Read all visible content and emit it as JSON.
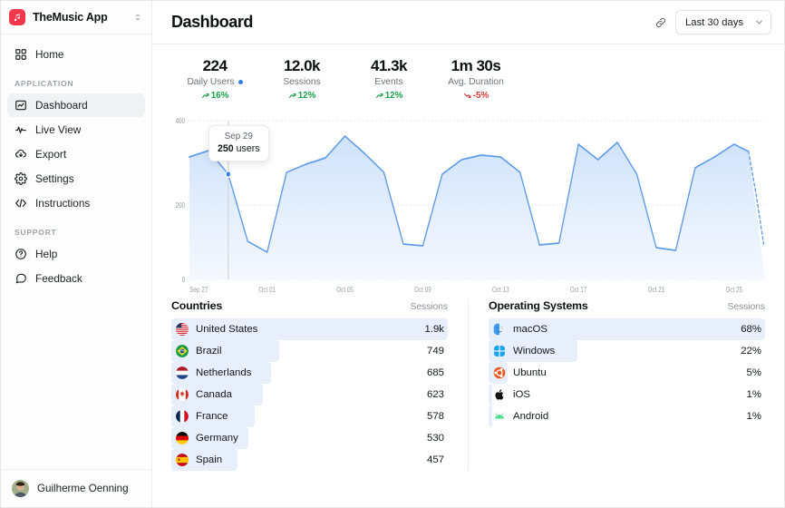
{
  "sidebar": {
    "brand": {
      "name": "TheMusic App",
      "logo_icon": "music-note-icon",
      "chevron_icon": "chevron-updown-icon",
      "logo_color": "#f2374a"
    },
    "top_items": [
      {
        "label": "Home",
        "icon": "grid-icon"
      }
    ],
    "groups": [
      {
        "label": "APPLICATION",
        "items": [
          {
            "label": "Dashboard",
            "icon": "chart-box-icon",
            "active": true
          },
          {
            "label": "Live View",
            "icon": "pulse-icon",
            "active": false
          },
          {
            "label": "Export",
            "icon": "cloud-download-icon",
            "active": false
          },
          {
            "label": "Settings",
            "icon": "gear-icon",
            "active": false
          },
          {
            "label": "Instructions",
            "icon": "code-icon",
            "active": false
          }
        ]
      },
      {
        "label": "SUPPORT",
        "items": [
          {
            "label": "Help",
            "icon": "question-circle-icon",
            "active": false
          },
          {
            "label": "Feedback",
            "icon": "chat-bubble-icon",
            "active": false
          }
        ]
      }
    ],
    "user": {
      "name": "Guilherme Oenning",
      "avatar_icon": "avatar"
    }
  },
  "header": {
    "title": "Dashboard",
    "link_icon": "link-icon",
    "date_range": {
      "value": "Last 30 days",
      "chevron_icon": "chevron-down-icon"
    }
  },
  "stats": [
    {
      "value": "224",
      "label": "Daily Users",
      "delta": "16%",
      "direction": "up",
      "has_dot": true,
      "dot_color": "#2e7ee8"
    },
    {
      "value": "12.0k",
      "label": "Sessions",
      "delta": "12%",
      "direction": "up",
      "has_dot": false
    },
    {
      "value": "41.3k",
      "label": "Events",
      "delta": "12%",
      "direction": "up",
      "has_dot": false
    },
    {
      "value": "1m 30s",
      "label": "Avg. Duration",
      "delta": "-5%",
      "direction": "down",
      "has_dot": false
    }
  ],
  "chart_data": {
    "type": "area",
    "title": "",
    "xlabel": "",
    "ylabel": "",
    "ylim": [
      0,
      400
    ],
    "yticks": [
      0,
      200,
      400
    ],
    "ytick_labels": [
      "0",
      "200",
      "400"
    ],
    "grid": true,
    "legend": null,
    "line_color": "#5e9bea",
    "fill_color": "#dbe9fb",
    "x": [
      "Sep 27",
      "Sep 28",
      "Sep 29",
      "Sep 30",
      "Oct 01",
      "Oct 02",
      "Oct 03",
      "Oct 04",
      "Oct 05",
      "Oct 06",
      "Oct 07",
      "Oct 08",
      "Oct 09",
      "Oct 10",
      "Oct 11",
      "Oct 12",
      "Oct 13",
      "Oct 14",
      "Oct 15",
      "Oct 16",
      "Oct 17",
      "Oct 18",
      "Oct 19",
      "Oct 20",
      "Oct 21",
      "Oct 22",
      "Oct 23",
      "Oct 24",
      "Oct 25",
      "Oct 26"
    ],
    "xtick_labels": [
      "Sep 27",
      "Oct 01",
      "Oct 05",
      "Oct 09",
      "Oct 13",
      "Oct 17",
      "Oct 21",
      "Oct 25"
    ],
    "values": [
      290,
      305,
      250,
      90,
      65,
      255,
      275,
      290,
      340,
      300,
      255,
      85,
      80,
      250,
      285,
      295,
      290,
      255,
      85,
      90,
      320,
      285,
      325,
      250,
      75,
      70,
      265,
      290,
      320,
      300
    ],
    "forecast_values": [
      300,
      230,
      150
    ],
    "highlight_point": {
      "x": "Sep 29",
      "y": 250
    },
    "tooltip": {
      "date": "Sep 29",
      "value": "250",
      "unit": "users"
    }
  },
  "countries_panel": {
    "title": "Countries",
    "value_header": "Sessions",
    "rows": [
      {
        "label": "United States",
        "value": "1.9k",
        "pct": 100,
        "flag": "flag-us"
      },
      {
        "label": "Brazil",
        "value": "749",
        "pct": 39,
        "flag": "flag-br"
      },
      {
        "label": "Netherlands",
        "value": "685",
        "pct": 36,
        "flag": "flag-nl"
      },
      {
        "label": "Canada",
        "value": "623",
        "pct": 33,
        "flag": "flag-ca"
      },
      {
        "label": "France",
        "value": "578",
        "pct": 30,
        "flag": "flag-fr"
      },
      {
        "label": "Germany",
        "value": "530",
        "pct": 28,
        "flag": "flag-de"
      },
      {
        "label": "Spain",
        "value": "457",
        "pct": 24,
        "flag": "flag-es"
      }
    ]
  },
  "os_panel": {
    "title": "Operating Systems",
    "value_header": "Sessions",
    "rows": [
      {
        "label": "macOS",
        "value": "68%",
        "pct": 100,
        "icon": "apple-finder-icon"
      },
      {
        "label": "Windows",
        "value": "22%",
        "pct": 32,
        "icon": "windows-icon"
      },
      {
        "label": "Ubuntu",
        "value": "5%",
        "pct": 7,
        "icon": "ubuntu-icon"
      },
      {
        "label": "iOS",
        "value": "1%",
        "pct": 1,
        "icon": "apple-icon"
      },
      {
        "label": "Android",
        "value": "1%",
        "pct": 1,
        "icon": "android-icon"
      }
    ]
  }
}
